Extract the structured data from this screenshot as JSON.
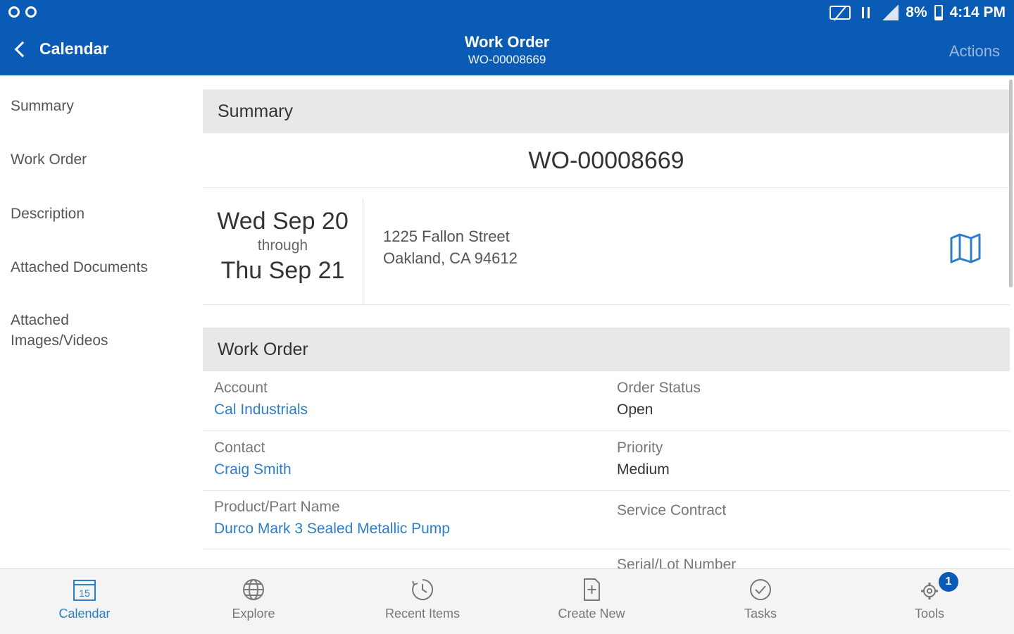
{
  "status_bar": {
    "battery": "8%",
    "time": "4:14 PM"
  },
  "header": {
    "back_label": "Calendar",
    "title": "Work Order",
    "subtitle": "WO-00008669",
    "actions_label": "Actions"
  },
  "left_nav": {
    "items": [
      {
        "label": "Summary"
      },
      {
        "label": "Work Order"
      },
      {
        "label": "Description"
      },
      {
        "label": "Attached Documents"
      },
      {
        "label": "Attached Images/Videos"
      }
    ]
  },
  "summary": {
    "heading": "Summary",
    "wo_number": "WO-00008669",
    "date_start": "Wed Sep 20",
    "date_through": "through",
    "date_end": "Thu Sep 21",
    "address_line1": "1225 Fallon Street",
    "address_line2": "Oakland, CA 94612"
  },
  "work_order": {
    "heading": "Work Order",
    "fields": {
      "account": {
        "label": "Account",
        "value": "Cal Industrials"
      },
      "order_status": {
        "label": "Order Status",
        "value": "Open"
      },
      "contact": {
        "label": "Contact",
        "value": "Craig Smith"
      },
      "priority": {
        "label": "Priority",
        "value": "Medium"
      },
      "product": {
        "label": "Product/Part Name",
        "value": "Durco Mark 3 Sealed Metallic Pump"
      },
      "service_contract": {
        "label": "Service Contract",
        "value": ""
      },
      "serial_lot": {
        "label": "Serial/Lot Number",
        "value": ""
      }
    }
  },
  "tabbar": {
    "tabs": [
      {
        "label": "Calendar",
        "icon": "calendar-icon",
        "calendar_day": "15"
      },
      {
        "label": "Explore",
        "icon": "globe-icon"
      },
      {
        "label": "Recent Items",
        "icon": "clock-icon"
      },
      {
        "label": "Create New",
        "icon": "new-document-icon"
      },
      {
        "label": "Tasks",
        "icon": "checkmark-icon"
      },
      {
        "label": "Tools",
        "icon": "gear-icon",
        "badge": "1"
      }
    ],
    "active_tab": "Calendar"
  },
  "colors": {
    "header_bg": "#0a5bb5",
    "link": "#2d7dc7",
    "section_bg": "#e8e8e8"
  }
}
